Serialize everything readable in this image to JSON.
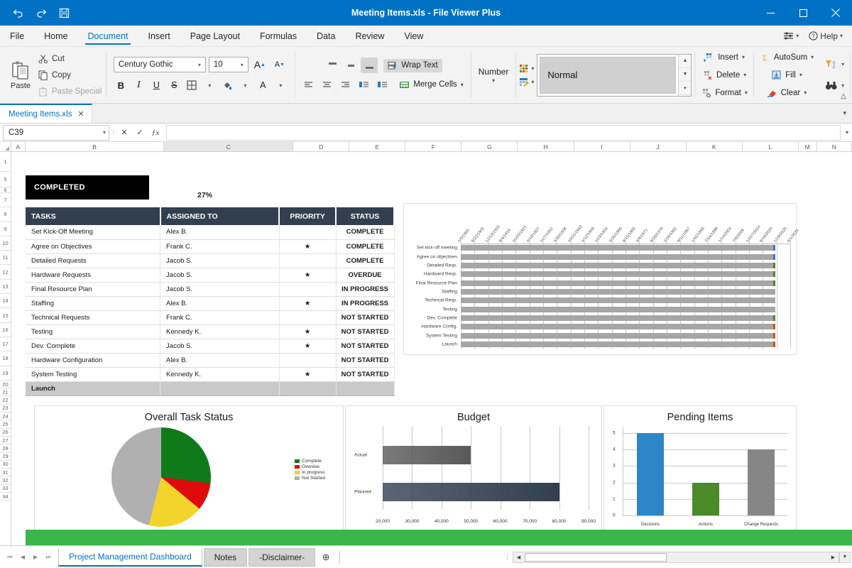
{
  "window": {
    "title": "Meeting Items.xls - File Viewer Plus",
    "accent": "#0072c6",
    "quick_access": [
      {
        "name": "undo-icon",
        "glyph": "↶"
      },
      {
        "name": "redo-icon",
        "glyph": "↷"
      },
      {
        "name": "save-icon",
        "glyph": "💾"
      }
    ],
    "controls": {
      "minimize": "─",
      "maximize": "☐",
      "close": "✕"
    }
  },
  "ribbon_tabs": [
    {
      "label": "File",
      "active": false
    },
    {
      "label": "Home",
      "active": false
    },
    {
      "label": "Document",
      "active": true
    },
    {
      "label": "Insert",
      "active": false
    },
    {
      "label": "Page Layout",
      "active": false
    },
    {
      "label": "Formulas",
      "active": false
    },
    {
      "label": "Data",
      "active": false
    },
    {
      "label": "Review",
      "active": false
    },
    {
      "label": "View",
      "active": false
    }
  ],
  "tabbar_right": {
    "settings_label": "",
    "help_label": "Help"
  },
  "ribbon": {
    "clipboard": {
      "paste_label": "Paste",
      "items": [
        {
          "label": "Cut",
          "icon": "scissors-icon",
          "disabled": false
        },
        {
          "label": "Copy",
          "icon": "copy-icon",
          "disabled": false
        },
        {
          "label": "Paste Special",
          "icon": "paste-special-icon",
          "disabled": true
        }
      ]
    },
    "font": {
      "family_value": "Century Gothic",
      "size_value": "10",
      "grow_label": "A",
      "shrink_label": "A",
      "bold_label": "B",
      "italic_label": "I",
      "underline_label": "U",
      "strike_label": "S",
      "border_label": "",
      "fill_label": "",
      "fontcolor_label": "A"
    },
    "alignment": {
      "wrap_label": "Wrap Text",
      "merge_label": "Merge Cells"
    },
    "number": {
      "label": "Number"
    },
    "styles": {
      "style_value": "Normal"
    },
    "cells": {
      "items": [
        {
          "label": "Insert",
          "icon": "insert-cells-icon"
        },
        {
          "label": "Delete",
          "icon": "delete-cells-icon"
        },
        {
          "label": "Format",
          "icon": "format-cells-icon"
        }
      ]
    },
    "editing": {
      "items": [
        {
          "label": "AutoSum",
          "icon": "autosum-icon"
        },
        {
          "label": "Fill",
          "icon": "fill-icon"
        },
        {
          "label": "Clear",
          "icon": "clear-icon"
        }
      ],
      "sort_icon": "sort-filter-icon",
      "find_icon": "find-binoculars-icon"
    }
  },
  "doc_tab": {
    "label": "Meeting Items.xls",
    "close_glyph": "✕"
  },
  "formula_bar": {
    "name_box_value": "C39",
    "cancel_glyph": "✕",
    "confirm_glyph": "✓",
    "fx_glyph": "ƒx",
    "formula_value": "",
    "expand_glyph": "▾"
  },
  "grid": {
    "columns": [
      "A",
      "B",
      "C",
      "D",
      "E",
      "F",
      "G",
      "H",
      "I",
      "J",
      "K",
      "L",
      "M",
      "N"
    ],
    "selected_column": "C",
    "rows": [
      "1",
      "5",
      "6",
      "7",
      "8",
      "9",
      "10",
      "11",
      "12",
      "13",
      "14",
      "15",
      "16",
      "17",
      "18",
      "19",
      "20",
      "21",
      "22",
      "23",
      "24",
      "25",
      "26",
      "27",
      "28",
      "29",
      "30",
      "31",
      "32",
      "33",
      "34"
    ]
  },
  "dashboard": {
    "banner_label": "COMPLETED",
    "completion_pct": "27%",
    "table": {
      "headers": [
        "TASKS",
        "ASSIGNED TO",
        "PRIORITY",
        "STATUS"
      ],
      "rows": [
        {
          "task": "Set Kick-Off Meeting",
          "assigned": "Alex B.",
          "priority": "",
          "status": "COMPLETE",
          "status_class": "st-complete"
        },
        {
          "task": "Agree on Objectives",
          "assigned": "Frank C.",
          "priority": "★",
          "status": "COMPLETE",
          "status_class": "st-complete"
        },
        {
          "task": "Detailed Requests",
          "assigned": "Jacob S.",
          "priority": "",
          "status": "COMPLETE",
          "status_class": "st-complete"
        },
        {
          "task": "Hardware Requests",
          "assigned": "Jacob S.",
          "priority": "★",
          "status": "OVERDUE",
          "status_class": "st-overdue"
        },
        {
          "task": "Final Resource Plan",
          "assigned": "Jacob S.",
          "priority": "",
          "status": "IN PROGRESS",
          "status_class": "st-progress"
        },
        {
          "task": "Staffing",
          "assigned": "Alex B.",
          "priority": "★",
          "status": "IN PROGRESS",
          "status_class": "st-progress"
        },
        {
          "task": "Technical Requests",
          "assigned": "Frank C.",
          "priority": "",
          "status": "NOT STARTED",
          "status_class": "st-notstarted"
        },
        {
          "task": "Testing",
          "assigned": "Kennedy K.",
          "priority": "★",
          "status": "NOT STARTED",
          "status_class": "st-notstarted"
        },
        {
          "task": "Dev. Complete",
          "assigned": "Jacob S.",
          "priority": "★",
          "status": "NOT STARTED",
          "status_class": "st-notstarted"
        },
        {
          "task": "Hardware Configuration",
          "assigned": "Alex B.",
          "priority": "",
          "status": "NOT STARTED",
          "status_class": "st-notstarted"
        },
        {
          "task": "System Testing",
          "assigned": "Kennedy K.",
          "priority": "★",
          "status": "NOT STARTED",
          "status_class": "st-notstarted"
        },
        {
          "task": "Launch",
          "assigned": "",
          "priority": "",
          "status": "",
          "status_class": ""
        }
      ]
    }
  },
  "chart_data": [
    {
      "type": "bar",
      "name": "gantt-chart",
      "orientation": "horizontal",
      "title": "",
      "categories": [
        "Set kick-off meeting",
        "Agree on objectives",
        "Detailed Reqs.",
        "Hardward Reqs.",
        "Final Resource Plan",
        "Staffing",
        "Techincal Reqs.",
        "Testing",
        "Dev. Complete",
        "Hardware Config.",
        "System Testing",
        "Launch"
      ],
      "tick_labels": [
        "1/0/1900",
        "6/22/1905",
        "12/13/1910",
        "6/4/1916",
        "11/25/1921",
        "5/18/1927",
        "11/7/1932",
        "4/30/1938",
        "10/21/1943",
        "4/12/1949",
        "10/3/1954",
        "3/25/1960",
        "9/15/1965",
        "3/8/1971",
        "8/28/1976",
        "2/18/1982",
        "8/11/1987",
        "1/31/1993",
        "7/24/1998",
        "1/14/2004",
        "7/6/2009",
        "12/27/2014",
        "6/18/2020",
        "12/9/2025",
        "6/1/2031"
      ],
      "bar_color": "#a6a6a6",
      "endcap_colors": [
        "#4472c4",
        "#4472c4",
        "#548235",
        "#548235",
        "#548235",
        "#a6a6a6",
        "#a6a6a6",
        "#a6a6a6",
        "#548235",
        "#c55a11",
        "#c55a11",
        "#c55a11"
      ],
      "grid": true,
      "legend": "none"
    },
    {
      "type": "pie",
      "name": "overall-task-status",
      "title": "Overall Task Status",
      "labels": [
        "Complete",
        "Overdue",
        "In progress",
        "Not Started"
      ],
      "values": [
        27,
        9,
        18,
        46
      ],
      "colors": [
        "#0f7a1a",
        "#e00a0a",
        "#f2d42a",
        "#b0b0b0"
      ],
      "legend": "right"
    },
    {
      "type": "bar",
      "name": "budget-chart",
      "orientation": "horizontal",
      "title": "Budget",
      "categories": [
        "Actual",
        "Planned"
      ],
      "values": [
        50000,
        80000
      ],
      "colors": [
        "#595959",
        "#323f4f"
      ],
      "xlim": [
        20000,
        90000
      ],
      "tick_labels": [
        "20,000",
        "30,000",
        "40,000",
        "50,000",
        "60,000",
        "70,000",
        "80,000",
        "90,000"
      ],
      "grid": true,
      "legend": "none"
    },
    {
      "type": "bar",
      "name": "pending-items-chart",
      "orientation": "vertical",
      "title": "Pending Items",
      "categories": [
        "Decisions",
        "Actions",
        "Change Requests"
      ],
      "values": [
        5,
        2,
        4
      ],
      "colors": [
        "#2e86c8",
        "#4a8a28",
        "#868686"
      ],
      "ylim": [
        0,
        5
      ],
      "tick_labels": [
        "0",
        "1",
        "2",
        "3",
        "4",
        "5"
      ],
      "grid": true,
      "legend": "none"
    }
  ],
  "sheet_bar": {
    "nav": [
      "⏮",
      "◀",
      "▶",
      "⏭"
    ],
    "sheets": [
      {
        "label": "Project Management Dashboard",
        "active": true
      },
      {
        "label": "Notes",
        "active": false
      },
      {
        "label": "-Disclaimer-",
        "active": false
      }
    ],
    "add_sheet_glyph": "⊕"
  }
}
